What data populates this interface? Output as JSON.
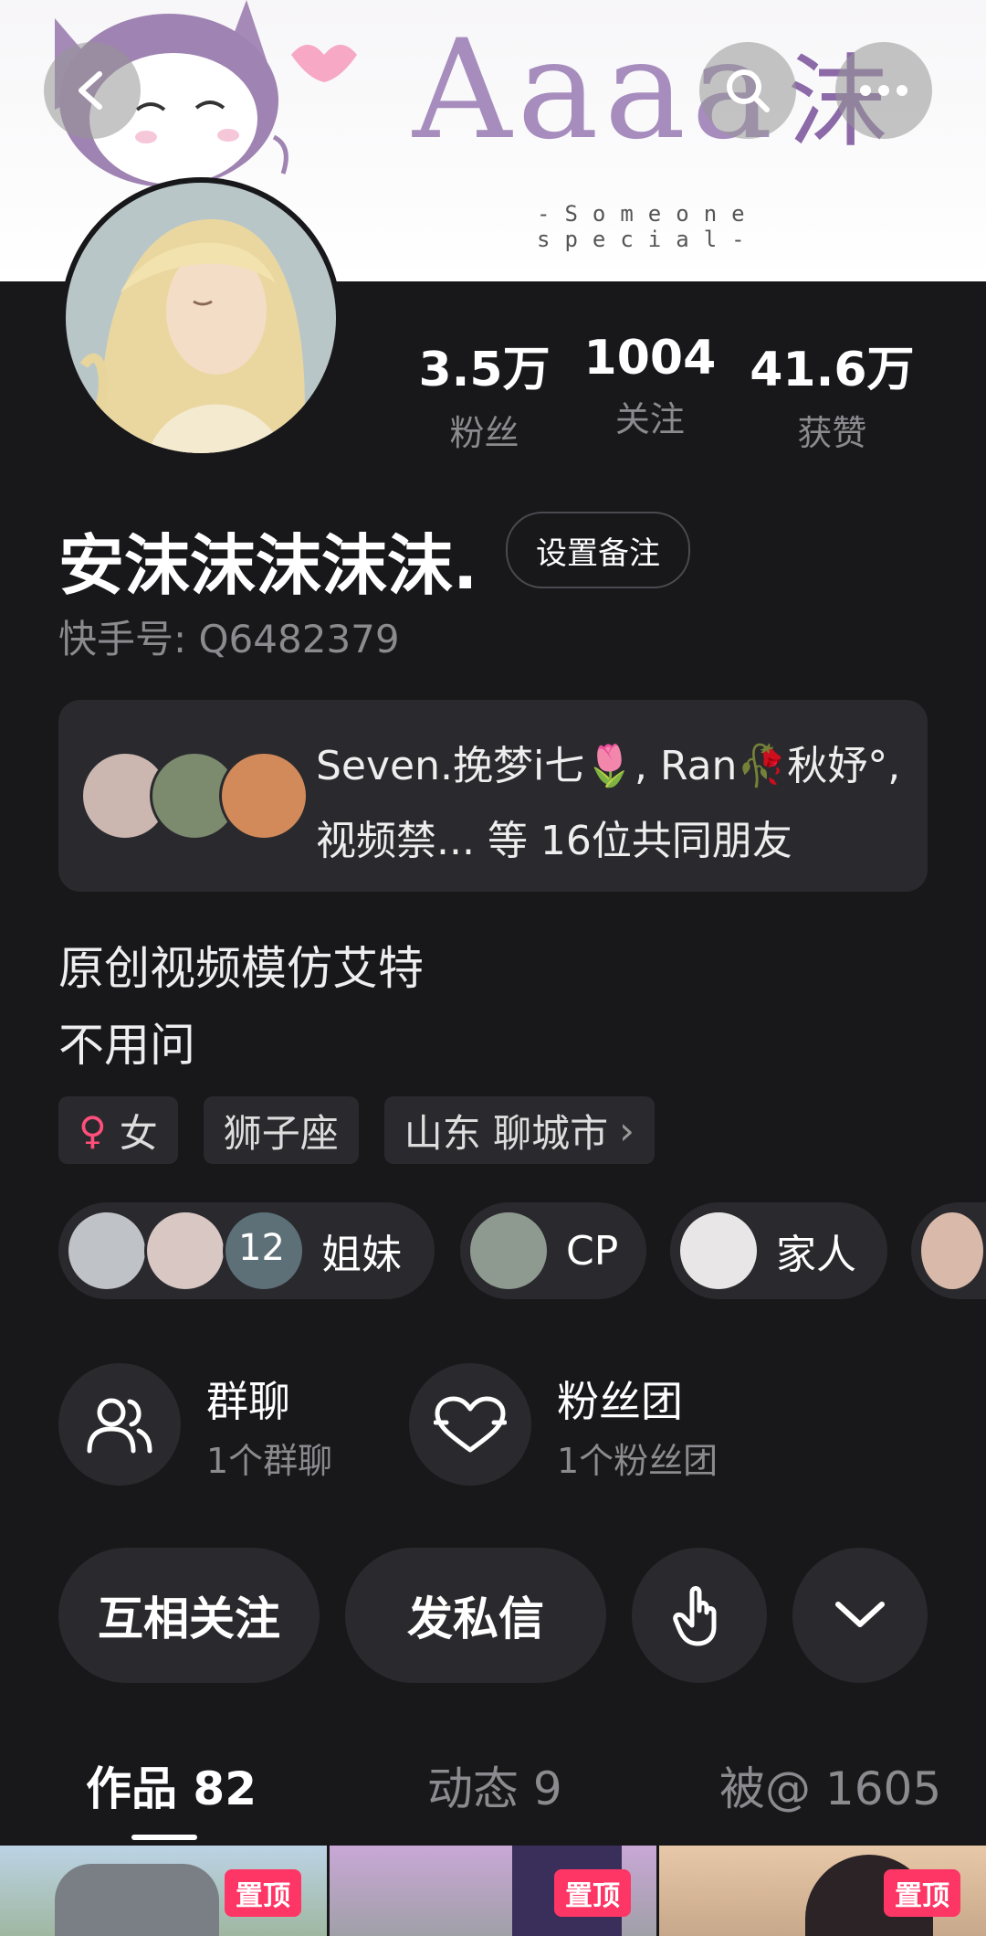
{
  "banner": {
    "title": "Aaaa",
    "title_char": "沫",
    "subtitle": "-Someone  special-"
  },
  "stats": [
    {
      "value": "3.5万",
      "label": "粉丝"
    },
    {
      "value": "1004",
      "label": "关注"
    },
    {
      "value": "41.6万",
      "label": "获赞"
    }
  ],
  "profile": {
    "name": "安沫沫沫沫沫.",
    "remark_button": "设置备注",
    "kwai_id": "快手号: Q6482379"
  },
  "mutual_friends": {
    "text": "Seven.挽梦i七🌷, Ran🥀秋妤°, 视频禁... 等 16位共同朋友"
  },
  "bio": {
    "line1": "原创视频模仿艾特",
    "line2": "不用问"
  },
  "tags": {
    "gender_symbol": "♀",
    "gender": "女",
    "zodiac": "狮子座",
    "location": "山东 聊城市",
    "location_arrow": "›"
  },
  "groups": [
    {
      "count": "12",
      "label": "姐妹"
    },
    {
      "label": "CP"
    },
    {
      "label": "家人"
    }
  ],
  "features": [
    {
      "title": "群聊",
      "sub": "1个群聊",
      "icon": "group-chat-icon"
    },
    {
      "title": "粉丝团",
      "sub": "1个粉丝团",
      "icon": "heart-icon"
    }
  ],
  "actions": {
    "follow": "互相关注",
    "message": "发私信"
  },
  "tabs": [
    {
      "label": "作品 82"
    },
    {
      "label": "动态 9"
    },
    {
      "label": "被@ 1605"
    }
  ],
  "thumbnails": {
    "pin_label": "置顶"
  },
  "colors": {
    "background": "#18181b",
    "card": "#2a2a2e",
    "pin": "#fe3666",
    "muted": "#8a8a8f"
  }
}
